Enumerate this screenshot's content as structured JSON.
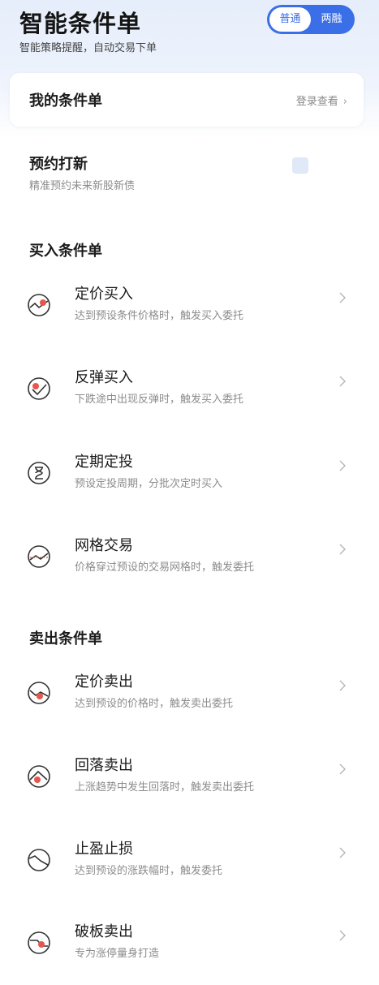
{
  "header": {
    "title": "智能条件单",
    "subtitle": "智能策略提醒，自动交易下单",
    "mode_toggle": {
      "options": [
        "普通",
        "两融"
      ],
      "selected": "普通"
    }
  },
  "my_orders": {
    "title": "我的条件单",
    "action": "登录查看"
  },
  "ipo": {
    "title": "预约打新",
    "subtitle": "精准预约未来新股新债"
  },
  "buy_section": {
    "heading": "买入条件单",
    "items": [
      {
        "title": "定价买入",
        "desc": "达到预设条件价格时，触发买入委托",
        "icon": "price-buy-icon"
      },
      {
        "title": "反弹买入",
        "desc": "下跌途中出现反弹时，触发买入委托",
        "icon": "rebound-buy-icon"
      },
      {
        "title": "定期定投",
        "desc": "预设定投周期，分批次定时买入",
        "icon": "hourglass-icon"
      },
      {
        "title": "网格交易",
        "desc": "价格穿过预设的交易网格时，触发委托",
        "icon": "grid-trade-icon"
      }
    ]
  },
  "sell_section": {
    "heading": "卖出条件单",
    "items": [
      {
        "title": "定价卖出",
        "desc": "达到预设的价格时，触发卖出委托",
        "icon": "price-sell-icon"
      },
      {
        "title": "回落卖出",
        "desc": "上涨趋势中发生回落时，触发卖出委托",
        "icon": "pullback-sell-icon"
      },
      {
        "title": "止盈止损",
        "desc": "达到预设的涨跌幅时，触发委托",
        "icon": "stop-profit-loss-icon"
      },
      {
        "title": "破板卖出",
        "desc": "专为涨停量身打造",
        "icon": "limit-break-sell-icon"
      }
    ]
  },
  "colors": {
    "accent": "#3b6fe8",
    "icon_red": "#e8554d",
    "text_secondary": "#8c8c8c"
  }
}
